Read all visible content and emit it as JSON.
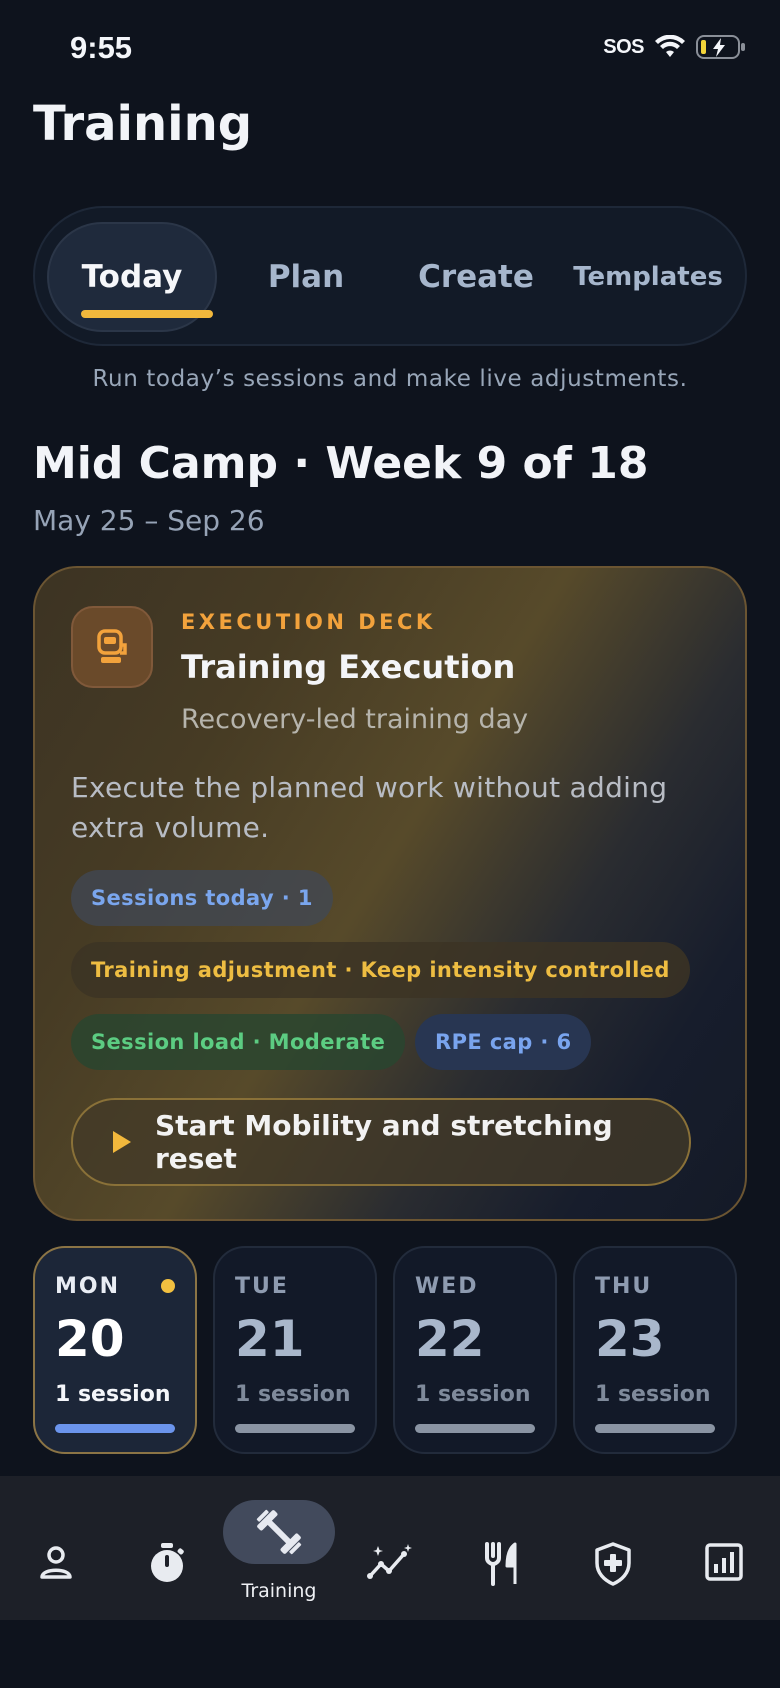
{
  "status_bar": {
    "time": "9:55",
    "carrier_label": "SOS",
    "icons": [
      "wifi-icon",
      "battery-charging-icon"
    ]
  },
  "page": {
    "title": "Training"
  },
  "tabs": [
    {
      "label": "Today",
      "active": true
    },
    {
      "label": "Plan",
      "active": false
    },
    {
      "label": "Create",
      "active": false
    },
    {
      "label": "Templates",
      "active": false
    }
  ],
  "tab_description": "Run today’s sessions and make live adjustments.",
  "camp": {
    "title": "Mid Camp · Week 9 of 18",
    "dates": "May 25 – Sep 26"
  },
  "execution_card": {
    "icon": "clipboard-icon",
    "eyebrow": "EXECUTION DECK",
    "title": "Training Execution",
    "subtitle": "Recovery-led training day",
    "description": "Execute the planned work without adding extra volume.",
    "chips": {
      "sessions": "Sessions today · 1",
      "adjustment": "Training adjustment · Keep intensity controlled",
      "load": "Session load · Moderate",
      "rpe": "RPE cap · 6"
    },
    "start_button": "Start Mobility and stretching reset"
  },
  "days": [
    {
      "name": "MON",
      "number": "20",
      "sessions": "1 session",
      "active": true,
      "has_dot": true
    },
    {
      "name": "TUE",
      "number": "21",
      "sessions": "1 session",
      "active": false
    },
    {
      "name": "WED",
      "number": "22",
      "sessions": "1 session",
      "active": false
    },
    {
      "name": "THU",
      "number": "23",
      "sessions": "1 session",
      "active": false
    }
  ],
  "bottom_nav": {
    "items": [
      {
        "icon": "profile-icon"
      },
      {
        "icon": "stopwatch-icon"
      },
      {
        "icon": "dumbbell-icon",
        "label": "Training",
        "active": true
      },
      {
        "icon": "progress-chart-icon"
      },
      {
        "icon": "nutrition-icon"
      },
      {
        "icon": "health-shield-icon"
      },
      {
        "icon": "reports-icon"
      }
    ]
  },
  "colors": {
    "background": "#0e131d",
    "accent_amber": "#f2b83c",
    "accent_blue": "#6b94ec",
    "eyebrow_orange": "#f2a23c",
    "chip_green": "#5ccc82"
  }
}
